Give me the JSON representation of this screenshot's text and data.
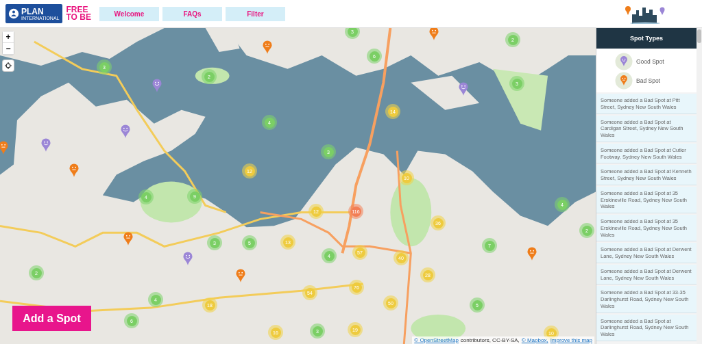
{
  "header": {
    "logo": {
      "name": "PLAN",
      "subtitle": "INTERNATIONAL"
    },
    "tagline": [
      "FREE",
      "TO BE"
    ],
    "nav": [
      {
        "label": "Welcome"
      },
      {
        "label": "FAQs"
      },
      {
        "label": "Filter"
      }
    ]
  },
  "map": {
    "zoom_in": "+",
    "zoom_out": "−",
    "clusters": [
      {
        "count": "3",
        "kind": "small"
      },
      {
        "count": "2",
        "kind": "small"
      },
      {
        "count": "4",
        "kind": "small"
      },
      {
        "count": "12",
        "kind": "medium"
      },
      {
        "count": "4",
        "kind": "small"
      },
      {
        "count": "9",
        "kind": "small"
      },
      {
        "count": "3",
        "kind": "small"
      },
      {
        "count": "5",
        "kind": "small"
      },
      {
        "count": "13",
        "kind": "medium"
      },
      {
        "count": "2",
        "kind": "small"
      },
      {
        "count": "4",
        "kind": "small"
      },
      {
        "count": "18",
        "kind": "medium"
      },
      {
        "count": "6",
        "kind": "small"
      },
      {
        "count": "16",
        "kind": "medium"
      },
      {
        "count": "3",
        "kind": "small"
      },
      {
        "count": "6",
        "kind": "small"
      },
      {
        "count": "2",
        "kind": "small"
      },
      {
        "count": "3",
        "kind": "small"
      },
      {
        "count": "14",
        "kind": "medium"
      },
      {
        "count": "3",
        "kind": "small"
      },
      {
        "count": "10",
        "kind": "medium"
      },
      {
        "count": "12",
        "kind": "medium"
      },
      {
        "count": "116",
        "kind": "large"
      },
      {
        "count": "36",
        "kind": "medium"
      },
      {
        "count": "4",
        "kind": "small"
      },
      {
        "count": "2",
        "kind": "small"
      },
      {
        "count": "7",
        "kind": "small"
      },
      {
        "count": "4",
        "kind": "small"
      },
      {
        "count": "57",
        "kind": "medium"
      },
      {
        "count": "40",
        "kind": "medium"
      },
      {
        "count": "28",
        "kind": "medium"
      },
      {
        "count": "76",
        "kind": "medium"
      },
      {
        "count": "54",
        "kind": "medium"
      },
      {
        "count": "50",
        "kind": "medium"
      },
      {
        "count": "5",
        "kind": "small"
      },
      {
        "count": "3",
        "kind": "small"
      },
      {
        "count": "19",
        "kind": "medium"
      },
      {
        "count": "10",
        "kind": "medium"
      }
    ],
    "spots": [
      {
        "kind": "bad"
      },
      {
        "kind": "bad"
      },
      {
        "kind": "bad"
      },
      {
        "kind": "bad"
      },
      {
        "kind": "bad"
      },
      {
        "kind": "bad"
      },
      {
        "kind": "bad"
      },
      {
        "kind": "good"
      },
      {
        "kind": "good"
      },
      {
        "kind": "good"
      },
      {
        "kind": "good"
      },
      {
        "kind": "good"
      }
    ],
    "attribution": [
      {
        "text": "© OpenStreetMap",
        "kind": "link"
      },
      {
        "text": "contributors, CC-BY-SA,",
        "kind": "text"
      },
      {
        "text": "© Mapbox,",
        "kind": "link"
      },
      {
        "text": "Improve this map",
        "kind": "link"
      }
    ]
  },
  "add_button": "Add a Spot",
  "sidebar": {
    "title": "Spot Types",
    "legend": [
      {
        "label": "Good Spot",
        "kind": "good"
      },
      {
        "label": "Bad Spot",
        "kind": "bad"
      }
    ],
    "feed": [
      "Someone added a Bad Spot at Pitt Street, Sydney New South Wales",
      "Someone added a Bad Spot at Cardigan Street, Sydney New South Wales",
      "Someone added a Bad Spot at Cutler Footway, Sydney New South Wales",
      "Someone added a Bad Spot at Kenneth Street, Sydney New South Wales",
      "Someone added a Bad Spot at 35 Erskineville Road, Sydney New South Wales",
      "Someone added a Bad Spot at 35 Erskineville Road, Sydney New South Wales",
      "Someone added a Bad Spot at Derwent Lane, Sydney New South Wales",
      "Someone added a Bad Spot at Derwent Lane, Sydney New South Wales",
      "Someone added a Bad Spot at 33-35 Darlinghurst Road, Sydney New South Wales",
      "Someone added a Bad Spot at Darlinghurst Road, Sydney New South Wales"
    ]
  }
}
